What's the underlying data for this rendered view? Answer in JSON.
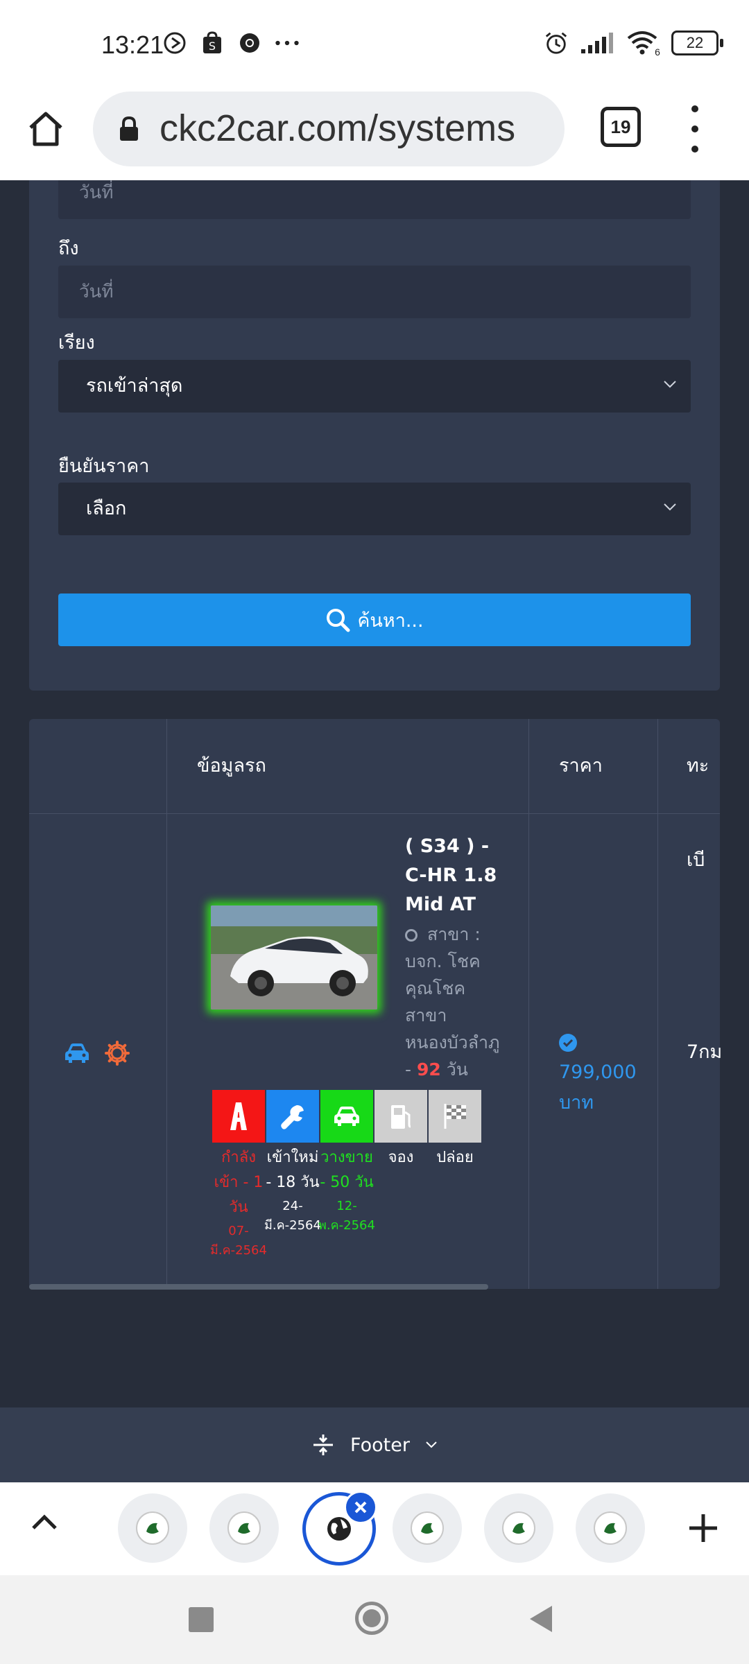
{
  "status_bar": {
    "time": "13:21",
    "battery": "22",
    "signal_sub": "6"
  },
  "browser": {
    "url": "ckc2car.com/systems",
    "tab_count": "19"
  },
  "filters": {
    "date_from_placeholder": "วันที่",
    "to_label": "ถึง",
    "date_to_placeholder": "วันที่",
    "sort_label": "เรียง",
    "sort_value": "รถเข้าล่าสุด",
    "confirm_price_label": "ยืนยันราคา",
    "confirm_price_value": "เลือก",
    "search_button": "ค้นหา..."
  },
  "table": {
    "headers": {
      "car_info": "ข้อมูลรถ",
      "price": "ราคา",
      "registration": "ทะเบี"
    },
    "row": {
      "title": "( S34 ) - C-HR 1.8 Mid AT",
      "branch_prefix": "สาขา : บจก. โชค คุณโชค สาขา หนองบัวลำภู -",
      "days_value": "92",
      "days_unit": "วัน",
      "price_amount": "799,000",
      "price_unit": "บาท",
      "date": "7กม"
    },
    "stages": [
      {
        "label": "กำลัง เข้า - 1 วัน",
        "date": "07- มี.ค-2564",
        "color": "#e52b2b",
        "bg": "#f41616",
        "icon": "road-icon"
      },
      {
        "label": "เข้าใหม่ - 18 วัน",
        "date": "24- มี.ค-2564",
        "color": "#ffffff",
        "bg": "#1d87f0",
        "icon": "wrench-icon"
      },
      {
        "label": "วางขาย - 50 วัน",
        "date": "12- พ.ค-2564",
        "color": "#1fe11f",
        "bg": "#17d917",
        "icon": "car-icon"
      },
      {
        "label": "จอง",
        "date": "",
        "color": "#ffffff",
        "bg": "#cfcfcf",
        "icon": "fuel-icon"
      },
      {
        "label": "ปล่อย",
        "date": "",
        "color": "#ffffff",
        "bg": "#cfcfcf",
        "icon": "flag-icon"
      }
    ]
  },
  "footer": {
    "label": "Footer"
  }
}
